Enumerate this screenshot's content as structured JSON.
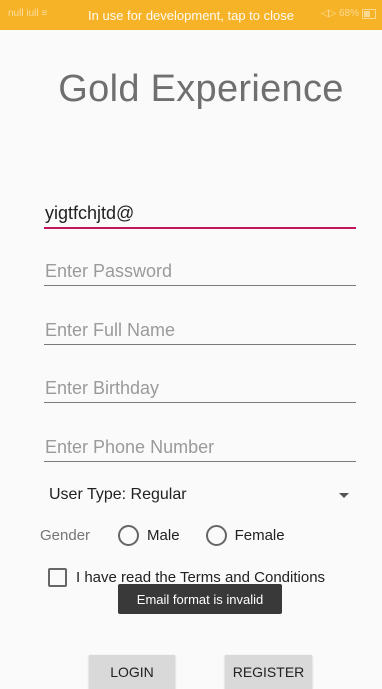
{
  "status_bar": {
    "left": "null iull ≡",
    "message": "In use for development, tap to close",
    "right": "◁▷ 68%",
    "accent_color": "#f6b327"
  },
  "app": {
    "title": "Gold Experience"
  },
  "form": {
    "email_value": "yigtfchjtd@",
    "password_placeholder": "Enter Password",
    "fullname_placeholder": "Enter Full Name",
    "birthday_placeholder": "Enter Birthday",
    "phone_placeholder": "Enter Phone Number",
    "user_type_selected": "User Type: Regular",
    "gender_label": "Gender",
    "gender_male": "Male",
    "gender_female": "Female",
    "terms_label": "I have read the Terms and Conditions"
  },
  "toast": {
    "message": "Email format is invalid"
  },
  "buttons": {
    "login": "LOGIN",
    "register": "REGISTER"
  }
}
